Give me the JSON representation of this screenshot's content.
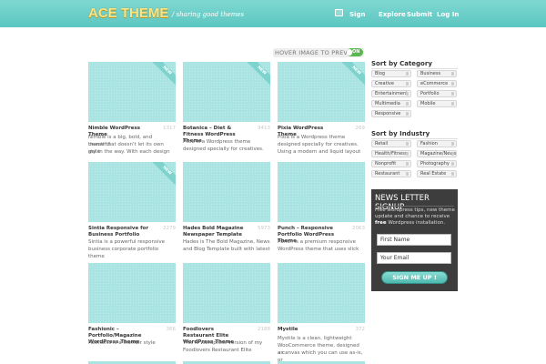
{
  "header": {
    "logo": "ACE THEME",
    "tagline": "/ sharing good themes",
    "nav": {
      "signin": "Sign",
      "explore": "Explore",
      "submit": "Submit",
      "login": "Log In"
    }
  },
  "toolbar": {
    "hover_label": "HOVER IMAGE TO PREVIEW",
    "toggle_label": "ON"
  },
  "badge": "NEW",
  "themes": [
    {
      "title": "Nimble WordPress Theme",
      "count": "1317",
      "new": true,
      "desc": [
        "Nimble is a big, bold, and beautiful",
        "theme that doesn't let its own style",
        "get in the way. With each design"
      ]
    },
    {
      "title": "Botanica – Diet & Fitness WordPress Theme",
      "count": "9413",
      "new": true,
      "desc": [
        "Pixia is a Wordpress theme",
        "designed specially for creatives."
      ]
    },
    {
      "title": "Pixia WordPress Theme",
      "count": "269",
      "new": true,
      "desc": [
        "Pixia is a Wordpress theme",
        "designed specially for creatives.",
        "Using a modern and liquid layout"
      ]
    },
    {
      "title": "Sintia Responsive for Business Portfolio",
      "count": "2279",
      "new": true,
      "desc": [
        "Sintia is a powerful responsive",
        "business corporate portfolio theme"
      ]
    },
    {
      "title": "Hades Bold Magazine Newspaper Template",
      "count": "5973",
      "new": false,
      "desc": [
        "Hades is The Bold Magazine, News",
        "and Blog Template built with latest"
      ]
    },
    {
      "title": "Punch – Responsive Portfolio WordPress Theme",
      "count": "2063",
      "new": false,
      "desc": [
        "Punch is a premium responsive",
        "WordPress theme that uses slick"
      ]
    },
    {
      "title": "Fashionic – Portfolio/Magazine WordPress Theme",
      "count": "366",
      "new": false,
      "desc": [
        "Fashionic is a trumblr style"
      ]
    },
    {
      "title": "Foodlovers Restaurant Elite WordPress Theme",
      "count": "2188",
      "new": false,
      "desc": [
        "This is Wordpress version of my",
        "Foodlovers Restaurant Elite"
      ]
    },
    {
      "title": "Mystile",
      "count": "372",
      "new": false,
      "desc": [
        "Mystile is a clean, lightweight",
        "WooCommerce theme, designed as",
        "a canvas which you can use as-is, or"
      ]
    }
  ],
  "sidebar": {
    "category_heading": "Sort by Category",
    "categories": [
      "Blog",
      "Business",
      "Creative",
      "eCommerce",
      "Entertainment",
      "Portfolio",
      "Multimedia",
      "Mobile",
      "Responsive"
    ],
    "industry_heading": "Sort by Industry",
    "industries": [
      "Retail",
      "Fashion",
      "Health/Fitness",
      "Magazine/News",
      "Nonprofit",
      "Photography",
      "Restaurant",
      "Real Estate"
    ]
  },
  "newsletter": {
    "title": "NEWS LETTER SIGNUP",
    "text_before": "Free wordpress tips, new theme update and chance to receive",
    "text_bold": "free",
    "text_after": "Wordpress installation.",
    "first_name_placeholder": "First Name",
    "email_placeholder": "Your Email",
    "button": "SIGN ME UP !"
  },
  "colors": {
    "header": "#5cc6c0",
    "thumb": "#a9e4e2",
    "accent": "#58b84f",
    "newsletter_bg": "#3d3d3d"
  }
}
